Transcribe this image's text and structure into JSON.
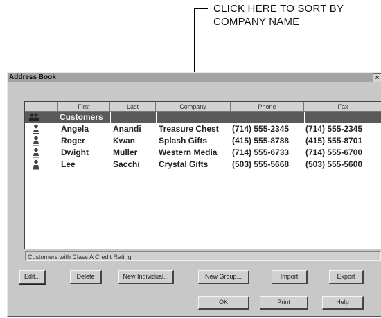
{
  "annotation": {
    "line1": "CLICK HERE TO SORT BY",
    "line2": "COMPANY NAME"
  },
  "window": {
    "title": "Address Book",
    "close_glyph": "×"
  },
  "table": {
    "headers": [
      "First",
      "Last",
      "Company",
      "Phone",
      "Fax"
    ],
    "group_row": {
      "label": "Customers",
      "icon": "group-icon"
    },
    "rows": [
      {
        "first": "Angela",
        "last": "Anandi",
        "company": "Treasure Chest",
        "phone": "(714) 555-2345",
        "fax": "(714) 555-2345",
        "icon": "person-icon"
      },
      {
        "first": "Roger",
        "last": "Kwan",
        "company": "Splash Gifts",
        "phone": "(415) 555-8788",
        "fax": "(415) 555-8701",
        "icon": "person-icon"
      },
      {
        "first": "Dwight",
        "last": "Muller",
        "company": "Western Media",
        "phone": "(714) 555-6733",
        "fax": "(714) 555-6700",
        "icon": "person-icon"
      },
      {
        "first": "Lee",
        "last": "Sacchi",
        "company": "Crystal Gifts",
        "phone": "(503) 555-5668",
        "fax": "(503) 555-5600",
        "icon": "person-icon"
      }
    ]
  },
  "status": {
    "text": "Customers with Class A Credit Rating"
  },
  "buttons": {
    "edit": "Edit...",
    "delete": "Delete",
    "new_individual": "New Individual...",
    "new_group": "New Group...",
    "import": "Import",
    "export": "Export",
    "ok": "OK",
    "print": "Print",
    "help": "Help"
  },
  "colors": {
    "selected_row": "#5a5a5a",
    "window_face": "#c8c8c8",
    "title_bar": "#a3a3a3"
  }
}
